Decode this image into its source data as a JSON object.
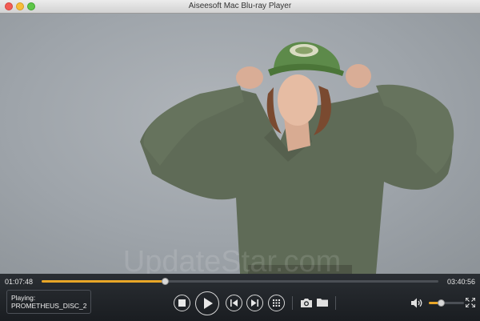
{
  "window": {
    "title": "Aiseesoft Mac Blu-ray Player"
  },
  "player": {
    "current_time": "01:07:48",
    "total_time": "03:40:56",
    "progress": 0.31,
    "now_playing_label": "Playing:",
    "now_playing_title": "PROMETHEUS_DISC_2",
    "volume": 0.35,
    "accent_color": "#e8a628"
  },
  "icons": [
    "stop-icon",
    "play-icon",
    "previous-icon",
    "next-icon",
    "menu-grid-icon",
    "camera-icon",
    "folder-icon",
    "speaker-icon",
    "fullscreen-icon"
  ]
}
